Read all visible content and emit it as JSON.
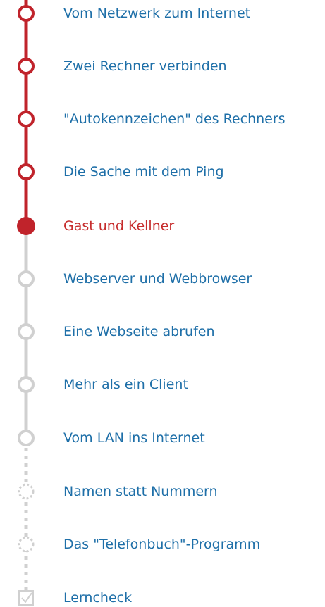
{
  "colors": {
    "done": "#c0232b",
    "pending": "#d0d0d0",
    "link": "#1e6fa8",
    "current_text": "#c62c2c"
  },
  "lessons": [
    {
      "label": "Vom Netzwerk zum Internet",
      "state": "done"
    },
    {
      "label": "Zwei Rechner verbinden",
      "state": "done"
    },
    {
      "label": "\"Autokennzeichen\" des Rechners",
      "state": "done"
    },
    {
      "label": "Die Sache mit dem Ping",
      "state": "done"
    },
    {
      "label": "Gast und Kellner",
      "state": "current"
    },
    {
      "label": "Webserver und Webbrowser",
      "state": "pending"
    },
    {
      "label": "Eine Webseite abrufen",
      "state": "pending"
    },
    {
      "label": "Mehr als ein Client",
      "state": "pending"
    },
    {
      "label": "Vom LAN ins Internet",
      "state": "pending"
    },
    {
      "label": "Namen statt Nummern",
      "state": "optional"
    },
    {
      "label": "Das \"Telefonbuch\"-Programm",
      "state": "optional"
    },
    {
      "label": "Lerncheck",
      "state": "check"
    }
  ]
}
